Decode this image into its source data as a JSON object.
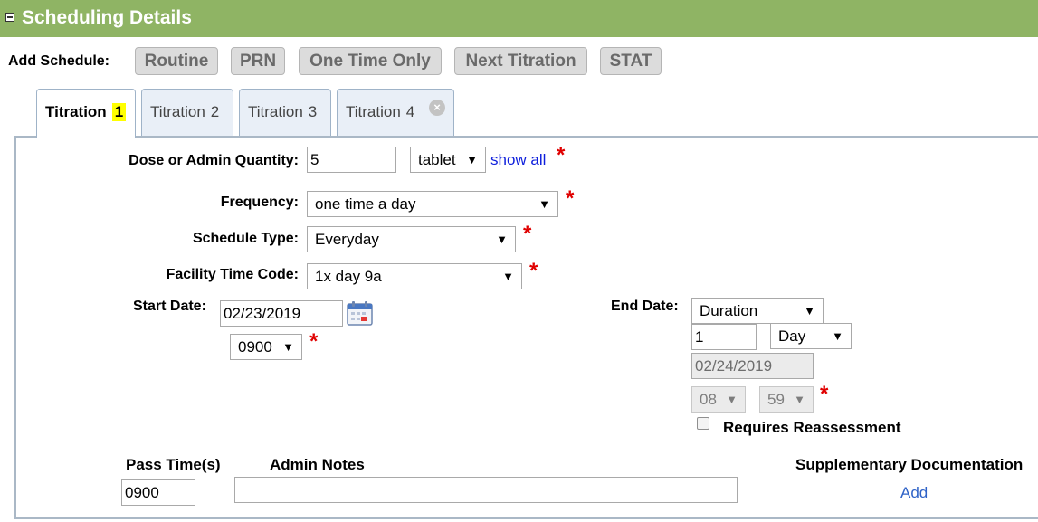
{
  "header": {
    "title": "Scheduling Details",
    "collapse_icon": "minus-square-icon"
  },
  "add_schedule": {
    "label": "Add Schedule:",
    "buttons": [
      "Routine",
      "PRN",
      "One Time Only",
      "Next Titration",
      "STAT"
    ]
  },
  "tabs": [
    {
      "label": "Titration",
      "num": "1",
      "active": true
    },
    {
      "label": "Titration",
      "num": "2"
    },
    {
      "label": "Titration",
      "num": "3"
    },
    {
      "label": "Titration",
      "num": "4",
      "close_icon": "close-circle-icon"
    }
  ],
  "dose": {
    "label": "Dose or Admin Quantity:",
    "value": "5",
    "unit": "tablet",
    "show_all": "show all"
  },
  "frequency": {
    "label": "Frequency:",
    "value": "one time a day"
  },
  "schedule_type": {
    "label": "Schedule Type:",
    "value": "Everyday"
  },
  "facility_time_code": {
    "label": "Facility Time Code:",
    "value": "1x day 9a"
  },
  "start_date": {
    "label": "Start Date:",
    "value": "02/23/2019",
    "time": "0900",
    "calendar_icon": "calendar-icon"
  },
  "end_date": {
    "label": "End Date:",
    "type": "Duration",
    "amount": "1",
    "unit": "Day",
    "date": "02/24/2019",
    "hour": "08",
    "minute": "59",
    "requires_reassessment": "Requires Reassessment"
  },
  "pass_times": {
    "label": "Pass Time(s)",
    "value": "0900"
  },
  "admin_notes": {
    "label": "Admin Notes",
    "value": ""
  },
  "supplementary": {
    "label": "Supplementary Documentation",
    "add": "Add"
  },
  "required_marker": "*",
  "dropdown_arrow": "▼",
  "colors": {
    "header_bg": "#8fb464",
    "required": "#e00000",
    "link": "#0d1edc",
    "highlight": "#ffff00"
  }
}
